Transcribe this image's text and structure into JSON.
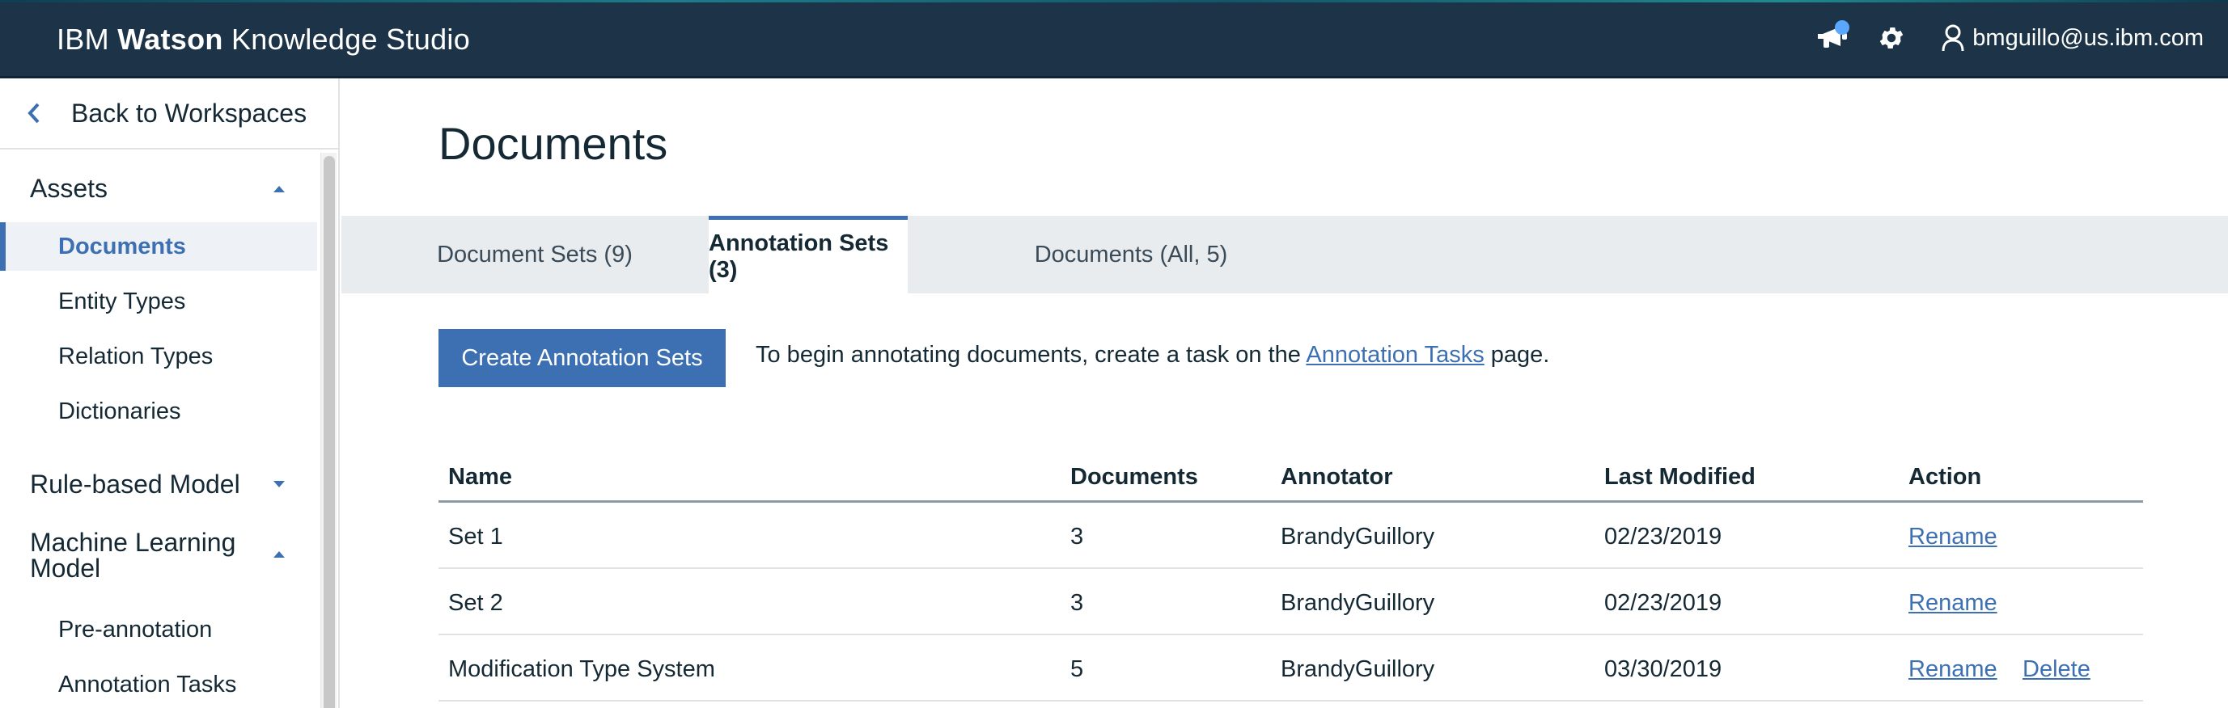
{
  "header": {
    "brand_prefix": "IBM",
    "brand_bold": "Watson",
    "brand_suffix": "Knowledge Studio",
    "user_email": "bmguillo@us.ibm.com"
  },
  "sidebar": {
    "back_label": "Back to Workspaces",
    "groups": [
      {
        "label": "Assets",
        "expanded": true,
        "items": [
          "Documents",
          "Entity Types",
          "Relation Types",
          "Dictionaries"
        ],
        "active_item": "Documents"
      },
      {
        "label": "Rule-based Model",
        "expanded": false,
        "items": []
      },
      {
        "label": "Machine Learning Model",
        "expanded": true,
        "items": [
          "Pre-annotation",
          "Annotation Tasks"
        ]
      }
    ]
  },
  "main": {
    "title": "Documents",
    "tabs": [
      {
        "label": "Document Sets (9)",
        "selected": false
      },
      {
        "label": "Annotation Sets (3)",
        "selected": true
      },
      {
        "label": "Documents (All, 5)",
        "selected": false
      }
    ],
    "create_button": "Create Annotation Sets",
    "hint": {
      "before": "To begin annotating documents, create a task on the",
      "link": "Annotation Tasks",
      "after": "page."
    },
    "table": {
      "columns": [
        "Name",
        "Documents",
        "Annotator",
        "Last Modified",
        "Action"
      ],
      "rows": [
        {
          "name": "Set 1",
          "documents": "3",
          "annotator": "BrandyGuillory",
          "last_modified": "02/23/2019",
          "actions": [
            "Rename"
          ]
        },
        {
          "name": "Set 2",
          "documents": "3",
          "annotator": "BrandyGuillory",
          "last_modified": "02/23/2019",
          "actions": [
            "Rename"
          ]
        },
        {
          "name": "Modification Type System",
          "documents": "5",
          "annotator": "BrandyGuillory",
          "last_modified": "03/30/2019",
          "actions": [
            "Rename",
            "Delete"
          ]
        }
      ]
    }
  },
  "colors": {
    "topbar": "#1d3448",
    "accent": "#3d70b2",
    "tabs_bg": "#e9ecee",
    "notification_dot": "#5aa7ff"
  }
}
